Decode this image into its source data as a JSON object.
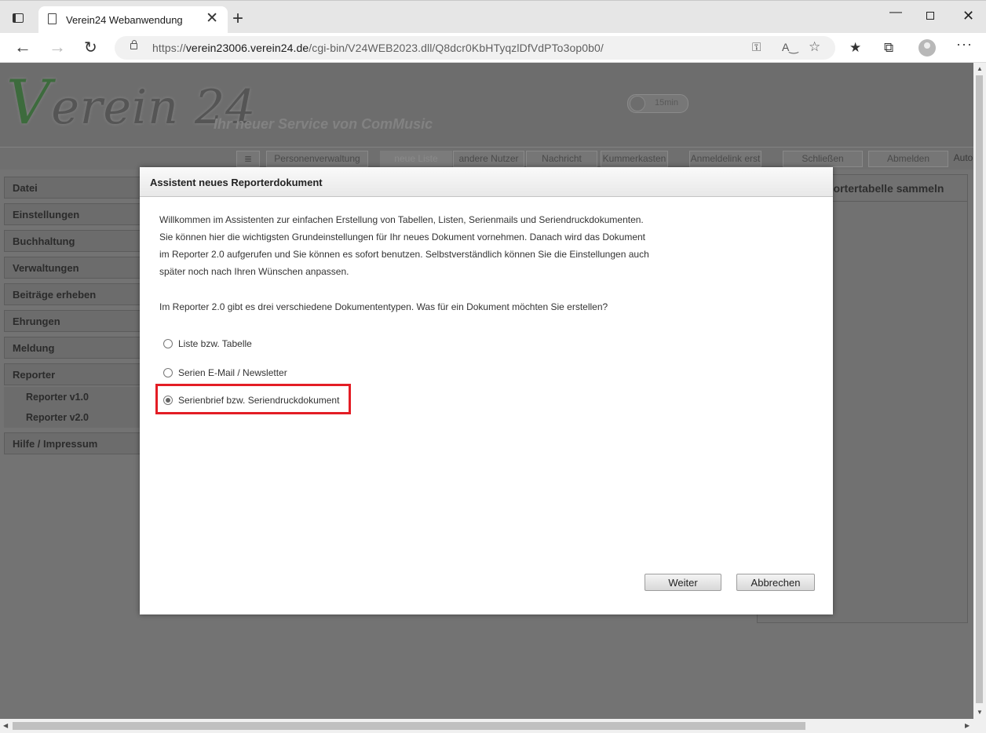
{
  "browser": {
    "tab_title": "Verein24 Webanwendung",
    "tab_close": "✕",
    "new_tab": "+",
    "url_host": "verein23006.verein24.de",
    "url_scheme": "https://",
    "url_path": "/cgi-bin/V24WEB2023.dll/Q8dcr0KbHTyqzlDfVdPTo3op0b0/"
  },
  "app": {
    "logo_v": "V",
    "logo_text": "erein 24",
    "slogan": "Ihr neuer Service von ComMusic",
    "timer": "15min",
    "menu": {
      "list_icon": "≣",
      "personenverwaltung": "Personenverwaltung",
      "neue_liste": "neue Liste",
      "andere_nutzer": "andere Nutzer",
      "nachricht": "Nachricht",
      "kummerkasten": "Kummerkasten",
      "anmeldelink": "Anmeldelink erst",
      "schliessen": "Schließen",
      "abmelden": "Abmelden",
      "auto": "Auto"
    },
    "sidebar": {
      "datei": "Datei",
      "einstellungen": "Einstellungen",
      "buchhaltung": "Buchhaltung",
      "verwaltungen": "Verwaltungen",
      "beitraege": "Beiträge erheben",
      "ehrungen": "Ehrungen",
      "meldung": "Meldung",
      "reporter": "Reporter",
      "reporter_v1": "Reporter v1.0",
      "reporter_v2": "Reporter v2.0",
      "hilfe": "Hilfe / Impressum"
    },
    "right_panel_title": "portertabelle sammeln"
  },
  "dialog": {
    "title": "Assistent neues Reporterdokument",
    "intro_lines": [
      "Willkommen im Assistenten zur einfachen Erstellung von Tabellen, Listen, Serienmails und Seriendruckdokumenten.",
      "Sie können hier die wichtigsten Grundeinstellungen für Ihr neues Dokument vornehmen. Danach wird das Dokument",
      "im Reporter 2.0 aufgerufen und Sie können es sofort benutzen. Selbstverständlich können Sie die Einstellungen auch",
      "später noch nach Ihren Wünschen anpassen."
    ],
    "question": "Im Reporter 2.0 gibt es drei verschiedene Dokumententypen. Was für ein Dokument möchten Sie erstellen?",
    "options": [
      {
        "label": "Liste bzw. Tabelle",
        "checked": false
      },
      {
        "label": "Serien E-Mail / Newsletter",
        "checked": false
      },
      {
        "label": "Serienbrief bzw. Seriendruckdokument",
        "checked": true
      }
    ],
    "highlight_color": "#e31d25",
    "weiter": "Weiter",
    "abbrechen": "Abbrechen"
  }
}
